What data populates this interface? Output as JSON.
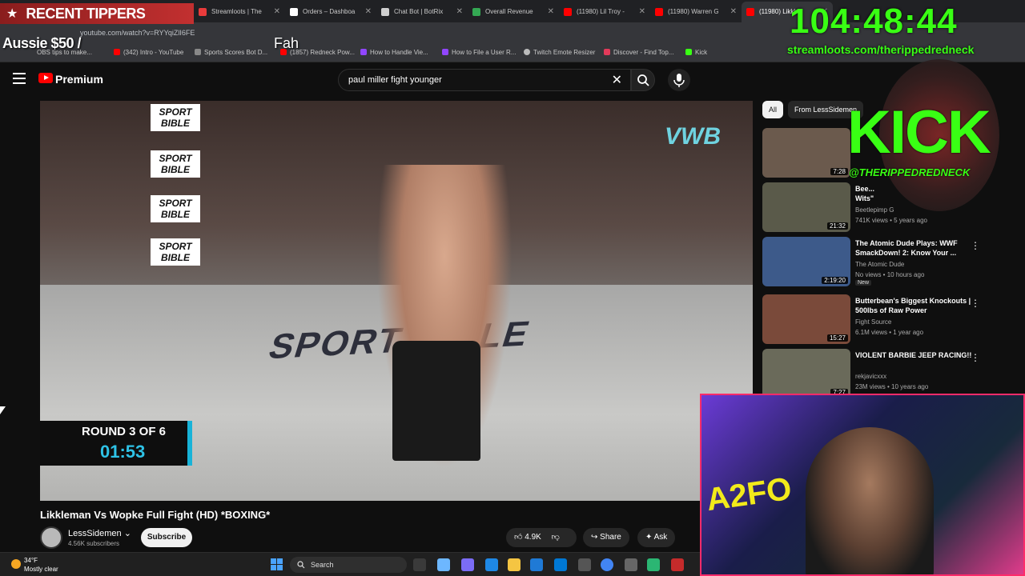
{
  "browser": {
    "url": "youtube.com/watch?v=RYYqiZlI6FE",
    "tabs": [
      {
        "label": "Streamloots | The",
        "color": "#e93b3b"
      },
      {
        "label": "Orders – Dashboa",
        "color": "#ffffff"
      },
      {
        "label": "Chat Bot | BotRix",
        "color": "#cfcfcf"
      },
      {
        "label": "Overall Revenue",
        "color": "#34a853"
      },
      {
        "label": "(11980) Lil Troy -",
        "color": "#ff0000"
      },
      {
        "label": "(11980) Warren G",
        "color": "#ff0000"
      },
      {
        "label": "(11980) Likkl",
        "color": "#ff0000",
        "active": true
      }
    ],
    "bookmarks": [
      "OBS tips to make...",
      "(342) Intro - YouTube",
      "Sports Scores Bot D...",
      "(1857) Redneck Pow...",
      "How to Handle Vie...",
      "How to File a User R...",
      "Twitch Emote Resizer",
      "Discover - Find Top...",
      "Kick"
    ]
  },
  "overlay": {
    "tippers_title": "RECENT TIPPERS",
    "tipper_name": "Aussie $50 /",
    "tipper_msg": "Fah",
    "timer": "104:48:44",
    "streamloots_url": "streamloots.com/therippedredneck",
    "kick_text": "KICK",
    "kick_handle": "@THERIPPEDREDNECK",
    "cam_sign": "A2FO",
    "accent_green": "#39ff14"
  },
  "youtube": {
    "brand": "Premium",
    "search_query": "paul miller fight younger",
    "video": {
      "banner_text": "SPORT BIBLE",
      "sponsor_text": "VWB",
      "mat_text": "SPORT BIBLE",
      "round_label": "ROUND 3 OF 6",
      "round_time": "01:53",
      "title": "Likkleman Vs Wopke Full Fight (HD) *BOXING*"
    },
    "channel": {
      "name": "LessSidemen",
      "subscribers": "4.56K subscribers",
      "subscribe_label": "Subscribe"
    },
    "actions": {
      "likes": "4.9K",
      "share": "Share",
      "ask": "Ask"
    },
    "chips": [
      "All",
      "From LessSidemen"
    ],
    "recommendations": [
      {
        "title": "",
        "channel": "",
        "views": "",
        "duration": "7:28",
        "thumb": "#6b5a4d"
      },
      {
        "title": "Bee...\nWits\"",
        "channel": "Beetlepimp G",
        "views": "741K views • 5 years ago",
        "duration": "21:32",
        "thumb": "#5a5a4a"
      },
      {
        "title": "The Atomic Dude Plays: WWF SmackDown! 2: Know Your ...",
        "channel": "The Atomic Dude",
        "views": "No views • 10 hours ago",
        "duration": "2:19:20",
        "thumb": "#3d5a8a",
        "badge": "New"
      },
      {
        "title": "Butterbean's Biggest Knockouts | 500lbs of Raw Power",
        "channel": "Fight Source",
        "views": "6.1M views • 1 year ago",
        "duration": "15:27",
        "thumb": "#7a4a3a"
      },
      {
        "title": "VIOLENT BARBIE JEEP RACING!!",
        "channel": "rekjavicxxx",
        "views": "23M views • 10 years ago",
        "duration": "7:27",
        "thumb": "#6a6a5a"
      }
    ]
  },
  "taskbar": {
    "temp": "34°F",
    "weather": "Mostly clear",
    "search": "Search"
  }
}
